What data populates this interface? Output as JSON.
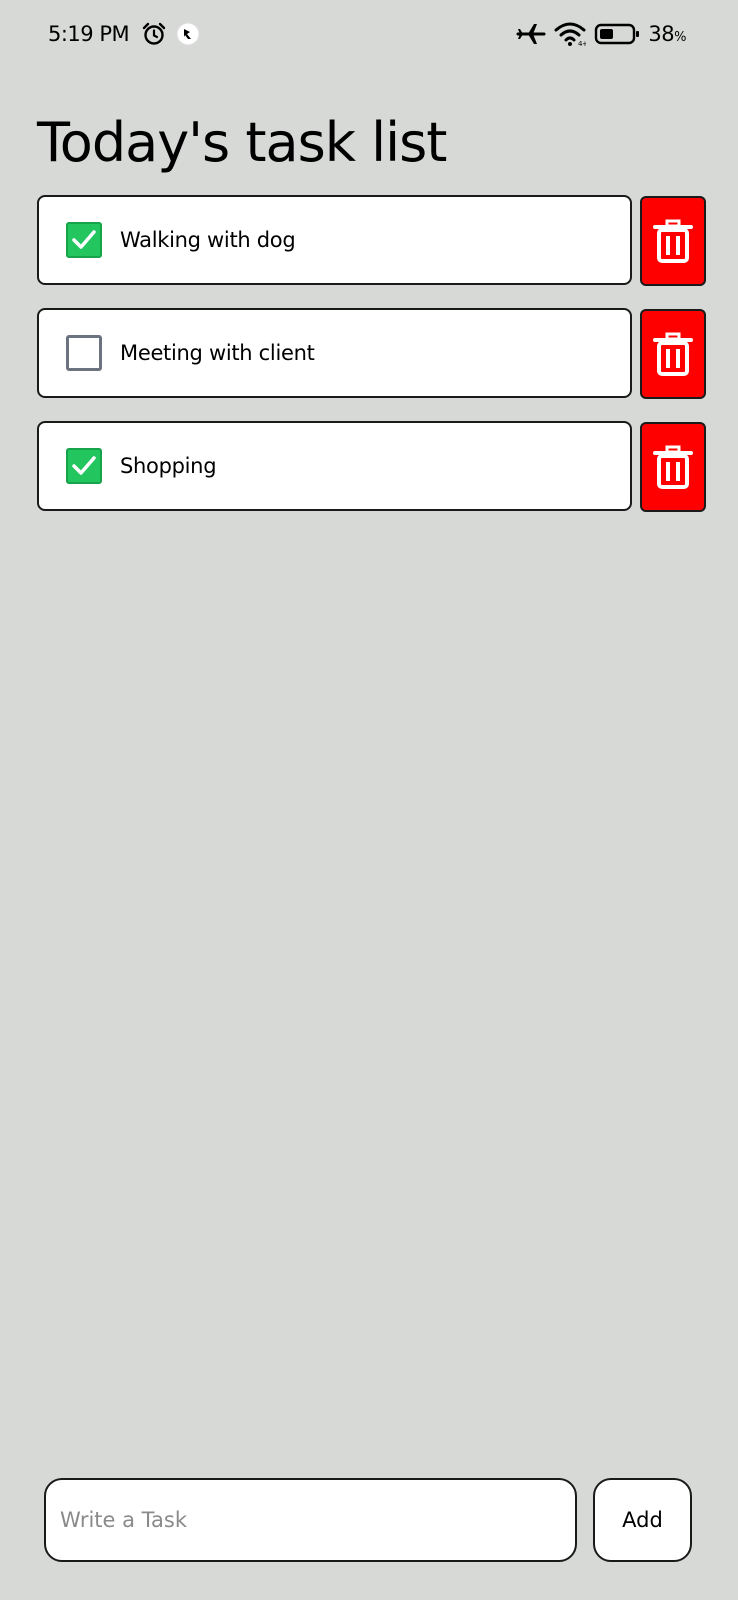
{
  "status_bar": {
    "time": "5:19 PM",
    "battery_percent": "38",
    "battery_suffix": "%",
    "icons": [
      "alarm-icon",
      "app-notification-icon",
      "airplane-mode-icon",
      "wifi-icon",
      "battery-icon"
    ]
  },
  "page": {
    "title": "Today's task list"
  },
  "tasks": [
    {
      "label": "Walking with dog",
      "checked": true
    },
    {
      "label": "Meeting with client",
      "checked": false
    },
    {
      "label": "Shopping",
      "checked": true
    }
  ],
  "input": {
    "placeholder": "Write a Task",
    "value": ""
  },
  "actions": {
    "add_label": "Add"
  },
  "colors": {
    "background": "#d7d9d7",
    "delete": "#ff0000",
    "checked": "#22c55e",
    "unchecked_border": "#6b7280"
  }
}
